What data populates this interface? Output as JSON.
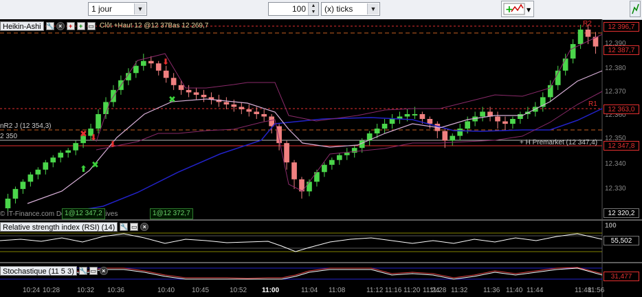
{
  "toolbar": {
    "period_value": "1 jour",
    "ticks_value": "100",
    "ticks_unit": "(x) ticks"
  },
  "main_panel": {
    "title": "Heikin-Ashi",
    "legend_text": "Clôt  +Haut 12 @12 37Bas 12 269,7",
    "pivot_r2j": "nR2 J (12 354,3)",
    "level_350": "2 350",
    "r2_label": "R2",
    "r1_label": "R1",
    "premarket_label": "+ H Premarket (12 347,4)",
    "watermark": "© IT-Finance.com  Données indicatives",
    "box1": "1@12 347,2",
    "box2": "1@12 372,7",
    "price_tags": [
      {
        "text": "12 396,7",
        "style": "red"
      },
      {
        "text": "12 387,7",
        "style": "red"
      },
      {
        "text": "12 363,0",
        "style": "red"
      },
      {
        "text": "12 347,8",
        "style": "red"
      },
      {
        "text": "12 320,2",
        "style": "white"
      }
    ],
    "y_ticks": [
      "12.390",
      "12.380",
      "12.370",
      "12.360",
      "12.350",
      "12.340",
      "12.330"
    ]
  },
  "rsi_panel": {
    "title": "Relative strength index (RSI) (14)",
    "value": "55,502",
    "top_tick": "100"
  },
  "stoch_panel": {
    "title": "Stochastique (11 5 3)",
    "value": "31,477"
  },
  "x_ticks": [
    "10:24",
    "10:28",
    "10:32",
    "10:36",
    "10:40",
    "10:45",
    "10:52",
    "11:00",
    "11:04",
    "11:08",
    "11:12",
    "11:16",
    "11:20",
    "11:24",
    "11:28",
    "11:32",
    "11:36",
    "11:40",
    "11:44",
    "11:48",
    "11:56"
  ],
  "chart_data": {
    "type": "candlestick",
    "title": "Heikin-Ashi",
    "ylim": [
      12320,
      12398
    ],
    "candles": [
      [
        12322,
        12326,
        12320,
        12328
      ],
      [
        12326,
        12330,
        12324,
        12331
      ],
      [
        12330,
        12333,
        12328,
        12334
      ],
      [
        12333,
        12336,
        12331,
        12337
      ],
      [
        12336,
        12338,
        12334,
        12339
      ],
      [
        12338,
        12341,
        12336,
        12342
      ],
      [
        12341,
        12343,
        12339,
        12344
      ],
      [
        12343,
        12345,
        12341,
        12346
      ],
      [
        12345,
        12346,
        12343,
        12347
      ],
      [
        12346,
        12349,
        12344,
        12350
      ],
      [
        12349,
        12352,
        12347,
        12353
      ],
      [
        12352,
        12355,
        12350,
        12357
      ],
      [
        12355,
        12361,
        12353,
        12363
      ],
      [
        12361,
        12366,
        12359,
        12368
      ],
      [
        12366,
        12371,
        12364,
        12373
      ],
      [
        12371,
        12375,
        12369,
        12377
      ],
      [
        12375,
        12378,
        12373,
        12380
      ],
      [
        12378,
        12381,
        12376,
        12383
      ],
      [
        12381,
        12383,
        12379,
        12386
      ],
      [
        12383,
        12382,
        12380,
        12385
      ],
      [
        12382,
        12379,
        12377,
        12383
      ],
      [
        12379,
        12376,
        12374,
        12381
      ],
      [
        12376,
        12373,
        12371,
        12378
      ],
      [
        12373,
        12371,
        12369,
        12375
      ],
      [
        12371,
        12370,
        12368,
        12373
      ],
      [
        12370,
        12369,
        12367,
        12372
      ],
      [
        12369,
        12368,
        12366,
        12371
      ],
      [
        12368,
        12367,
        12365,
        12370
      ],
      [
        12367,
        12366,
        12364,
        12369
      ],
      [
        12366,
        12365,
        12363,
        12368
      ],
      [
        12365,
        12364,
        12362,
        12367
      ],
      [
        12364,
        12363,
        12361,
        12366
      ],
      [
        12363,
        12362,
        12360,
        12365
      ],
      [
        12362,
        12361,
        12359,
        12364
      ],
      [
        12361,
        12360,
        12358,
        12363
      ],
      [
        12360,
        12356,
        12353,
        12361
      ],
      [
        12356,
        12349,
        12346,
        12357
      ],
      [
        12349,
        12341,
        12338,
        12350
      ],
      [
        12341,
        12334,
        12330,
        12342
      ],
      [
        12334,
        12329,
        12326,
        12335
      ],
      [
        12329,
        12333,
        12327,
        12334
      ],
      [
        12333,
        12337,
        12331,
        12338
      ],
      [
        12337,
        12340,
        12335,
        12341
      ],
      [
        12340,
        12342,
        12338,
        12343
      ],
      [
        12342,
        12344,
        12340,
        12345
      ],
      [
        12344,
        12345,
        12342,
        12347
      ],
      [
        12345,
        12347,
        12343,
        12348
      ],
      [
        12347,
        12350,
        12345,
        12351
      ],
      [
        12350,
        12353,
        12348,
        12354
      ],
      [
        12353,
        12355,
        12351,
        12357
      ],
      [
        12355,
        12357,
        12353,
        12359
      ],
      [
        12357,
        12359,
        12355,
        12361
      ],
      [
        12359,
        12360,
        12357,
        12362
      ],
      [
        12360,
        12361,
        12358,
        12363
      ],
      [
        12361,
        12361,
        12359,
        12364
      ],
      [
        12361,
        12359,
        12357,
        12362
      ],
      [
        12359,
        12357,
        12355,
        12360
      ],
      [
        12357,
        12354,
        12351,
        12358
      ],
      [
        12354,
        12350,
        12347,
        12355
      ],
      [
        12350,
        12352,
        12348,
        12353
      ],
      [
        12352,
        12355,
        12350,
        12357
      ],
      [
        12355,
        12358,
        12353,
        12360
      ],
      [
        12358,
        12360,
        12356,
        12362
      ],
      [
        12360,
        12362,
        12358,
        12364
      ],
      [
        12362,
        12360,
        12358,
        12364
      ],
      [
        12360,
        12358,
        12355,
        12362
      ],
      [
        12358,
        12357,
        12354,
        12360
      ],
      [
        12357,
        12359,
        12355,
        12360
      ],
      [
        12359,
        12361,
        12357,
        12362
      ],
      [
        12361,
        12362,
        12359,
        12364
      ],
      [
        12362,
        12364,
        12360,
        12366
      ],
      [
        12364,
        12368,
        12362,
        12370
      ],
      [
        12368,
        12373,
        12366,
        12375
      ],
      [
        12373,
        12379,
        12371,
        12381
      ],
      [
        12379,
        12384,
        12377,
        12386
      ],
      [
        12384,
        12390,
        12382,
        12392
      ],
      [
        12390,
        12396,
        12388,
        12398
      ],
      [
        12396,
        12393,
        12390,
        12398
      ],
      [
        12393,
        12389,
        12386,
        12395
      ]
    ],
    "series": [
      {
        "name": "MA short",
        "color": "#c8a0c8"
      },
      {
        "name": "MA long",
        "color": "#2020c0"
      }
    ]
  }
}
